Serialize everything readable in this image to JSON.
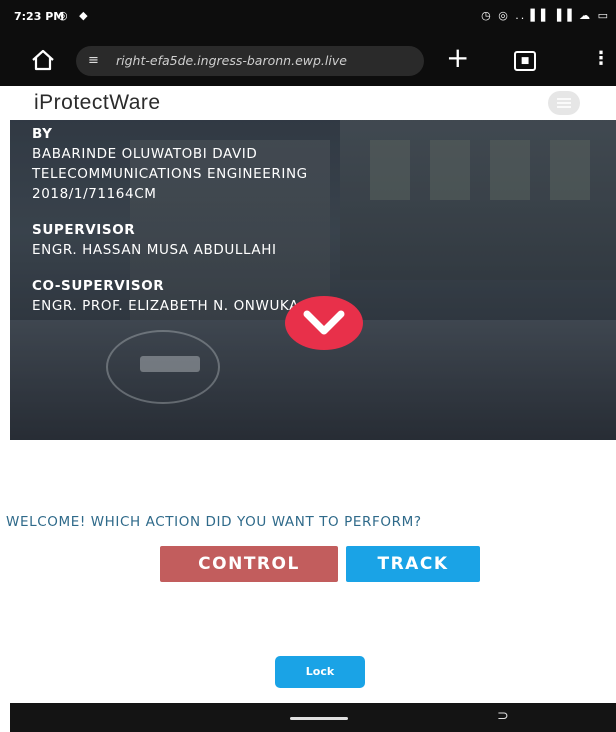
{
  "status_bar": {
    "time": "7:23 PM",
    "left_icons": "◎ ◆",
    "right_icons": "◷ ◎ ..▐▐ ▐▐ ☁ ▭"
  },
  "browser": {
    "url": "right-efa5de.ingress-baronn.ewp.live",
    "tab_count": "■",
    "menu_icon": "⋮",
    "plus_icon": "+"
  },
  "site": {
    "brand": "iProtectWare"
  },
  "hero": {
    "by_label": "BY",
    "author_name": "BABARINDE OLUWATOBI DAVID",
    "department": "TELECOMMUNICATIONS ENGINEERING",
    "matric": "2018/1/71164CM",
    "supervisor_label": "SUPERVISOR",
    "supervisor_name": "ENGR. HASSAN MUSA ABDULLAHI",
    "cosupervisor_label": "CO-SUPERVISOR",
    "cosupervisor_name": "ENGR. PROF. ELIZABETH N. ONWUKA"
  },
  "content": {
    "welcome": "WELCOME! WHICH ACTION DID YOU WANT TO PERFORM?",
    "control_label": "CONTROL",
    "track_label": "TRACK",
    "lock_label": "Lock"
  },
  "colors": {
    "control": "#c25d5d",
    "track": "#1aa3e6",
    "chevron": "#e8304a",
    "welcome_text": "#2f6a8a"
  },
  "icons": [
    "home-icon",
    "tune-icon",
    "plus-icon",
    "tabs-icon",
    "menu-icon",
    "hamburger-icon",
    "chevron-down-icon",
    "key-icon",
    "back-icon"
  ]
}
